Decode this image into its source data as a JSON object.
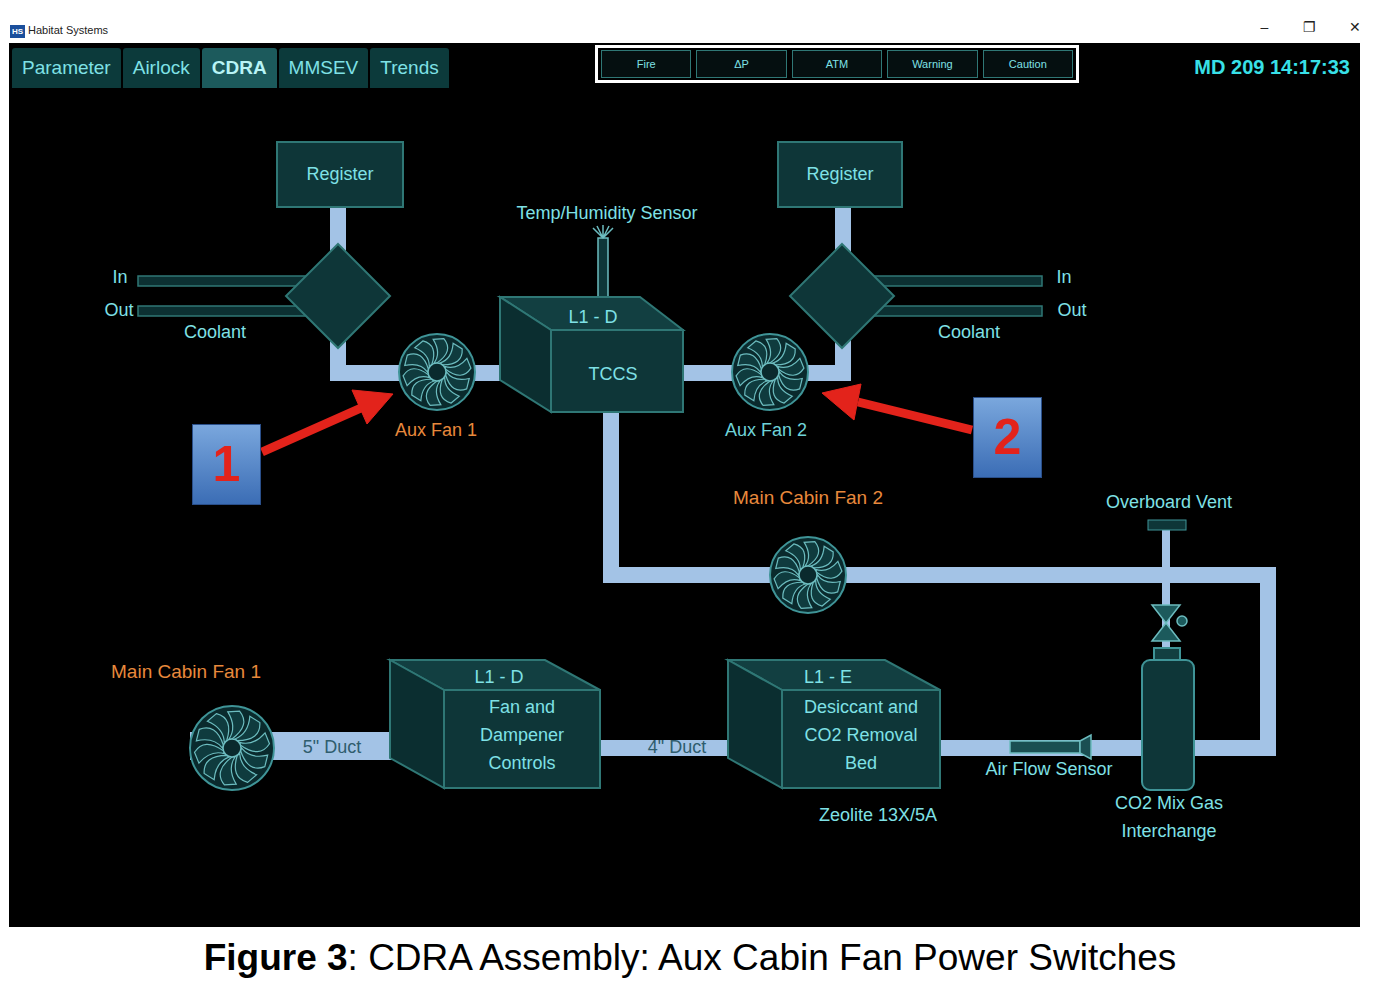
{
  "window": {
    "title": "Habitat Systems",
    "icon": "HS",
    "controls": [
      "–",
      "❐",
      "✕"
    ]
  },
  "tabs": [
    {
      "label": "Parameter",
      "selected": false
    },
    {
      "label": "Airlock",
      "selected": false
    },
    {
      "label": "CDRA",
      "selected": true
    },
    {
      "label": "MMSEV",
      "selected": false
    },
    {
      "label": "Trends",
      "selected": false
    }
  ],
  "alarms": [
    "Fire",
    "ΔP",
    "ATM",
    "Warning",
    "Caution"
  ],
  "clock": "MD 209 14:17:33",
  "diagram": {
    "registers": [
      "Register",
      "Register"
    ],
    "coolant": [
      {
        "label": "Coolant",
        "in": "In",
        "out": "Out"
      },
      {
        "label": "Coolant",
        "in": "In",
        "out": "Out"
      }
    ],
    "sensor": "Temp/Humidity Sensor",
    "tccs": {
      "code": "L1 - D",
      "name": "TCCS"
    },
    "fans": [
      {
        "label": "Aux Fan 1",
        "color": "#e8893c"
      },
      {
        "label": "Aux Fan 2",
        "color": "#6fd3d8"
      },
      {
        "label": "Main Cabin Fan 2",
        "color": "#e8893c"
      },
      {
        "label": "Main Cabin Fan 1",
        "color": "#e8893c"
      }
    ],
    "callouts": [
      "1",
      "2"
    ],
    "units": [
      {
        "code": "L1 - D",
        "lines": [
          "Fan and",
          "Dampener",
          "Controls"
        ]
      },
      {
        "code": "L1 - E",
        "lines": [
          "Desiccant and",
          "CO2 Removal",
          "Bed"
        ]
      }
    ],
    "ducts": [
      "5\" Duct",
      "4\" Duct"
    ],
    "bed_material": "Zeolite 13X/5A",
    "airflow": "Air Flow Sensor",
    "vent": "Overboard Vent",
    "interchange": [
      "CO2 Mix Gas",
      "Interchange"
    ]
  },
  "caption": {
    "number": "Figure 3",
    "text": ": CDRA Assembly: Aux Cabin Fan Power Switches"
  }
}
